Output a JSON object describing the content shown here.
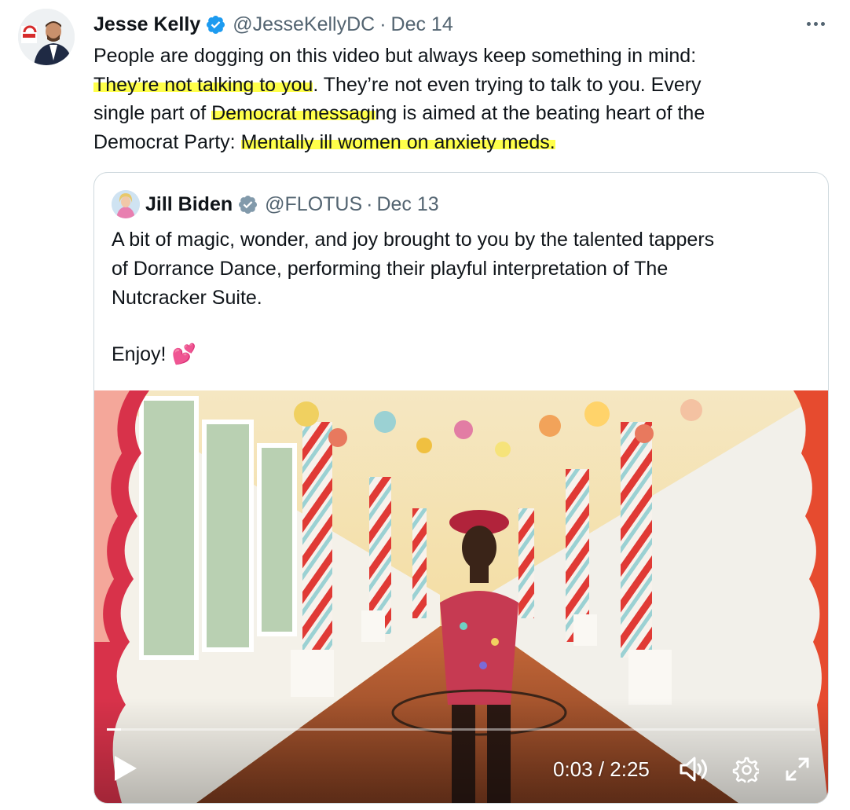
{
  "tweet": {
    "author_name": "Jesse Kelly",
    "handle": "@JesseKellyDC",
    "separator": "·",
    "date": "Dec 14",
    "lines": [
      [
        {
          "t": "People are dogging on this video but always keep something in mind:",
          "hl": false
        }
      ],
      [
        {
          "t": "They’re not talking to you",
          "hl": true
        },
        {
          "t": ". They’re not even trying to talk to you. Every",
          "hl": false
        }
      ],
      [
        {
          "t": "single part of ",
          "hl": false
        },
        {
          "t": "Democrat messagi",
          "hl": true
        },
        {
          "t": "ng is aimed at the beating heart of the",
          "hl": false
        }
      ],
      [
        {
          "t": "Democrat Party: ",
          "hl": false
        },
        {
          "t": "Mentally ill women on anxiety meds.",
          "hl": true
        }
      ]
    ],
    "highlight_color": "#ffff4a"
  },
  "quoted": {
    "author_name": "Jill Biden",
    "handle": "@FLOTUS",
    "separator": "·",
    "date": "Dec 13",
    "lines": [
      "A bit of magic, wonder, and joy brought to you by the talented tappers",
      "of Dorrance Dance, performing their playful interpretation of The",
      "Nutcracker Suite."
    ],
    "closing": "Enjoy!",
    "emoji": "💕",
    "video": {
      "time_display": "0:03 / 2:25",
      "progress": 0.02
    }
  },
  "colors": {
    "verified_blue": "#1d9bf0",
    "verified_gray": "#829aab",
    "secondary_text": "#536471",
    "border": "#cfd9de"
  }
}
